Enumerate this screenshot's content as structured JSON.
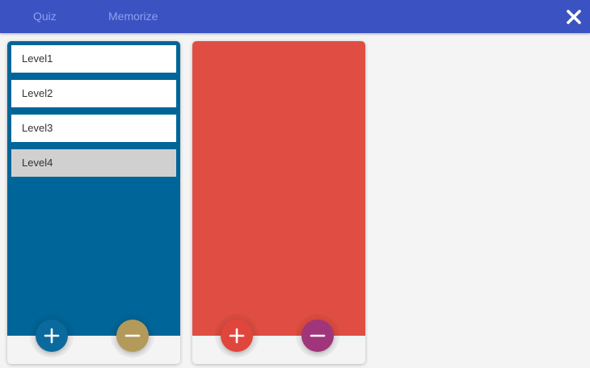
{
  "header": {
    "tabs": [
      {
        "label": "Quiz"
      },
      {
        "label": "Memorize"
      }
    ],
    "close_icon": "close-icon",
    "background_color": "#3a52c2"
  },
  "levels_panel": {
    "color": "#006699",
    "items": [
      {
        "label": "Level1",
        "selected": false
      },
      {
        "label": "Level2",
        "selected": false
      },
      {
        "label": "Level3",
        "selected": false
      },
      {
        "label": "Level4",
        "selected": true
      }
    ],
    "add_button": {
      "icon": "plus-icon",
      "color": "#0a6a9e"
    },
    "remove_button": {
      "icon": "minus-icon",
      "color": "#b39a5a"
    }
  },
  "second_panel": {
    "color": "#e04e43",
    "items": [],
    "add_button": {
      "icon": "plus-icon",
      "color": "#e0463c"
    },
    "remove_button": {
      "icon": "minus-icon",
      "color": "#a0357c"
    }
  }
}
